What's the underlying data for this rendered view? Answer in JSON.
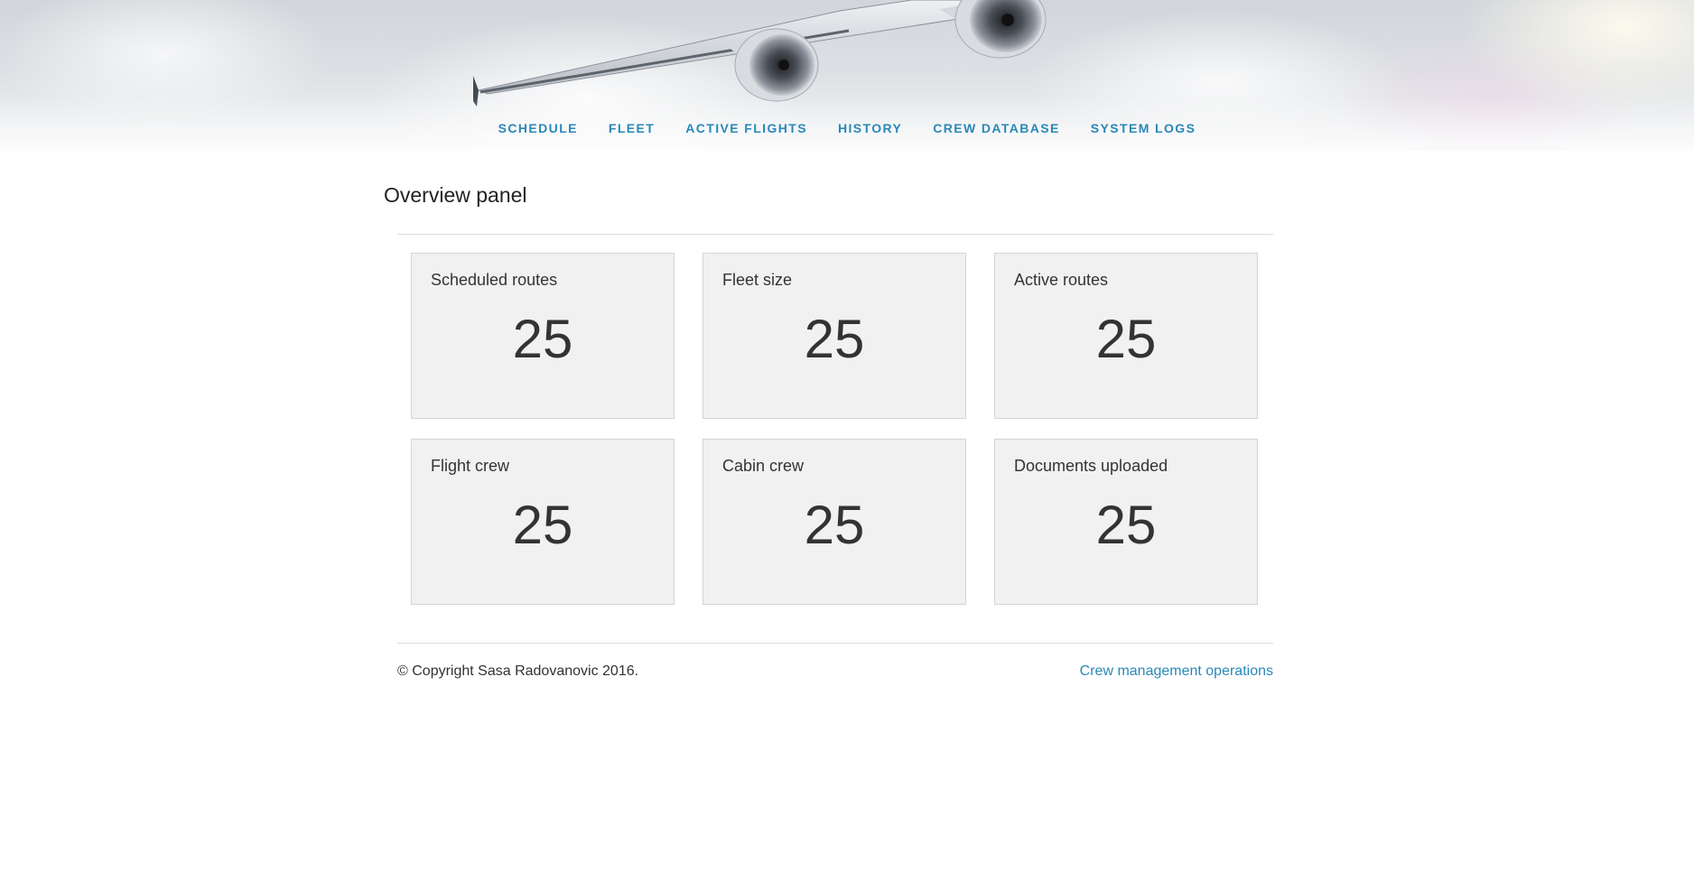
{
  "nav": {
    "items": [
      {
        "label": "SCHEDULE"
      },
      {
        "label": "FLEET"
      },
      {
        "label": "ACTIVE FLIGHTS"
      },
      {
        "label": "HISTORY"
      },
      {
        "label": "CREW DATABASE"
      },
      {
        "label": "SYSTEM LOGS"
      }
    ]
  },
  "main": {
    "title": "Overview panel",
    "cards": [
      {
        "label": "Scheduled routes",
        "value": "25"
      },
      {
        "label": "Fleet size",
        "value": "25"
      },
      {
        "label": "Active routes",
        "value": "25"
      },
      {
        "label": "Flight crew",
        "value": "25"
      },
      {
        "label": "Cabin crew",
        "value": "25"
      },
      {
        "label": "Documents uploaded",
        "value": "25"
      }
    ]
  },
  "footer": {
    "copyright": "© Copyright Sasa Radovanovic 2016.",
    "link": "Crew management operations"
  },
  "colors": {
    "link": "#2a88b8",
    "card_background": "#f1f1f1",
    "text": "#333333"
  },
  "header": {
    "image": "airplane-in-clouds"
  }
}
